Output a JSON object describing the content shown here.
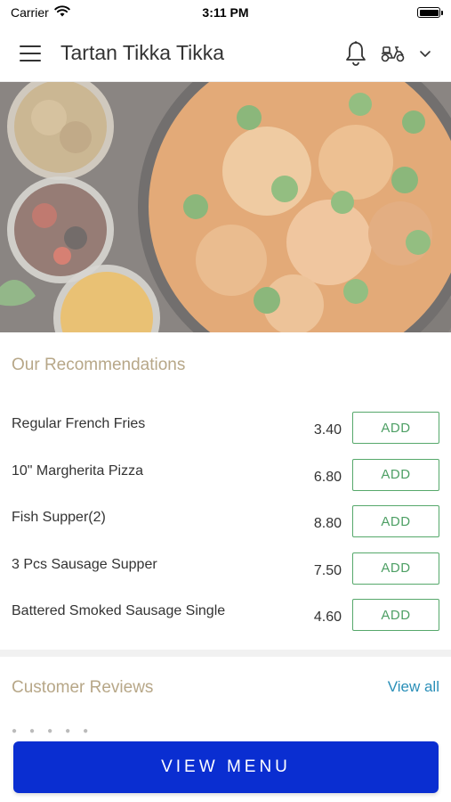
{
  "status_bar": {
    "carrier": "Carrier",
    "time": "3:11 PM"
  },
  "header": {
    "title": "Tartan Tikka Tikka",
    "icons": [
      "menu-icon",
      "bell-icon",
      "scooter-icon",
      "chevron-down-icon"
    ]
  },
  "hero": {
    "image": "food-photo"
  },
  "recommendations": {
    "heading": "Our Recommendations",
    "items": [
      {
        "name": "Regular French Fries",
        "price": "3.40",
        "action": "ADD"
      },
      {
        "name": "10\" Margherita Pizza",
        "price": "6.80",
        "action": "ADD"
      },
      {
        "name": "Fish Supper(2)",
        "price": "8.80",
        "action": "ADD"
      },
      {
        "name": "3 Pcs Sausage Supper",
        "price": "7.50",
        "action": "ADD"
      },
      {
        "name": "Battered Smoked Sausage Single",
        "price": "4.60",
        "action": "ADD"
      }
    ]
  },
  "reviews": {
    "heading": "Customer Reviews",
    "view_all": "View all"
  },
  "footer": {
    "view_menu": "VIEW MENU"
  },
  "colors": {
    "heading_gold": "#b7a788",
    "add_green": "#56a86b",
    "link_blue": "#2a8fb8",
    "primary_button": "#0a2ed1"
  }
}
